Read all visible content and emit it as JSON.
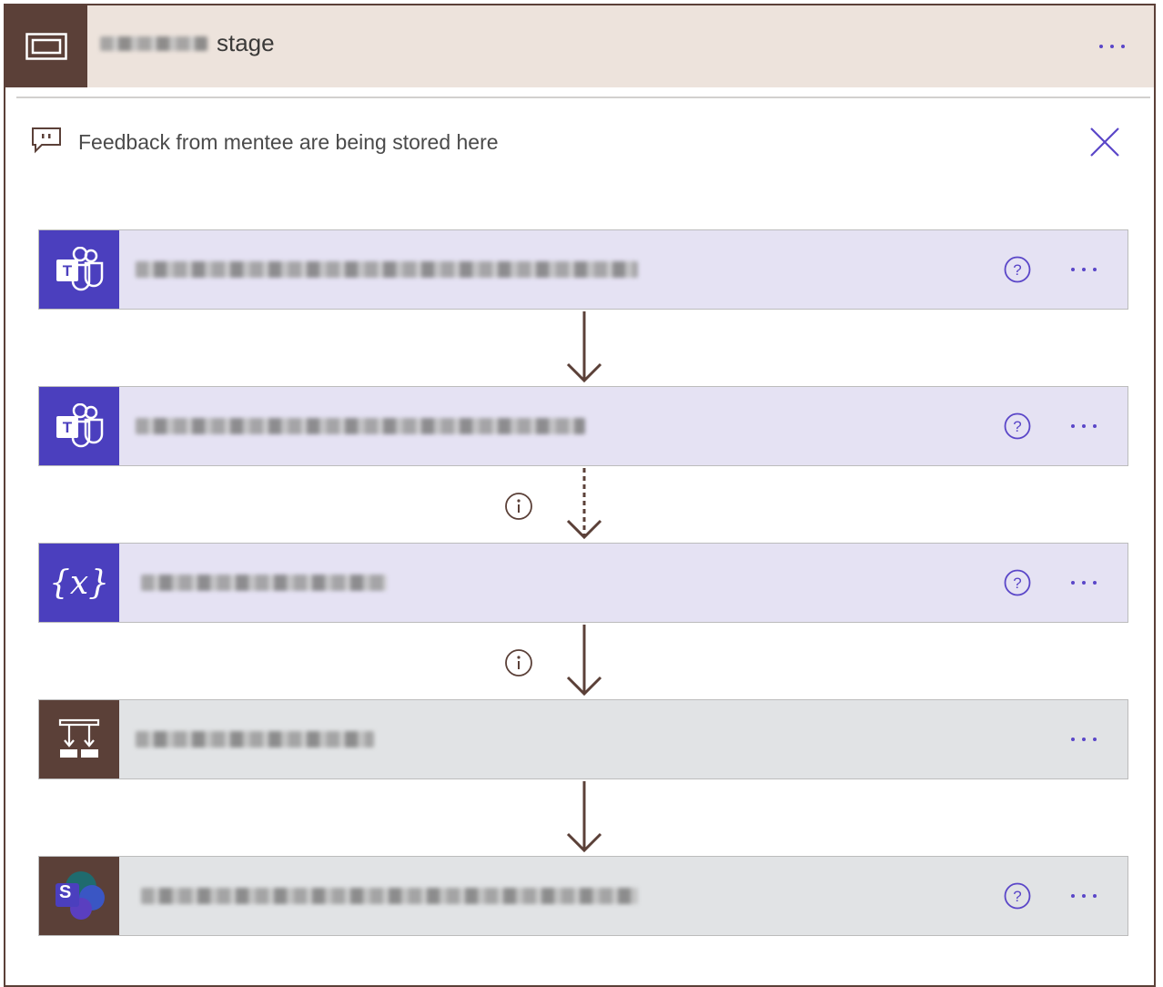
{
  "scope": {
    "title_suffix": "stage",
    "icon": "scope-frame-icon",
    "more_icon": "ellipsis-icon"
  },
  "comment": {
    "text": "Feedback from mentee are being stored here",
    "icon": "comment-icon",
    "close_icon": "close-icon"
  },
  "actions": [
    {
      "connector": "Microsoft Teams",
      "icon": "teams-icon",
      "has_help": true,
      "style": "teams"
    },
    {
      "connector": "Microsoft Teams",
      "icon": "teams-icon",
      "has_help": true,
      "style": "teams"
    },
    {
      "connector": "Variables",
      "icon": "variable-icon",
      "icon_text": "{x}",
      "has_help": true,
      "style": "teams"
    },
    {
      "connector": "Control",
      "icon": "parallel-branch-icon",
      "has_help": false,
      "style": "gray"
    },
    {
      "connector": "SharePoint",
      "icon": "sharepoint-icon",
      "icon_text": "S",
      "has_help": true,
      "style": "gray"
    }
  ],
  "colors": {
    "scope_brown": "#5b4038",
    "scope_header_bg": "#ede3dc",
    "teams_purple": "#4b3fbe",
    "accent_purple": "#5a46c8",
    "arrow_brown": "#5b4038"
  }
}
